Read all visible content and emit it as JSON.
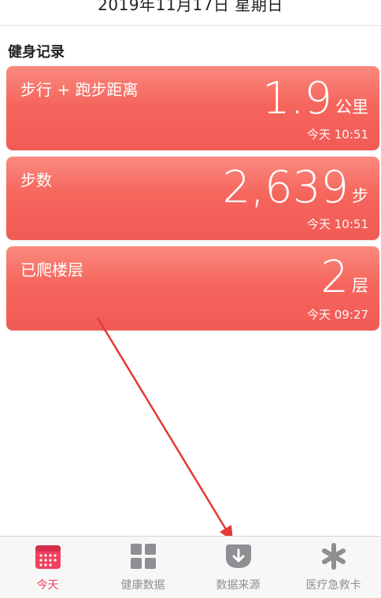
{
  "header": {
    "date": "2019年11月17日 星期日"
  },
  "section": {
    "title": "健身记录"
  },
  "cards": [
    {
      "label": "步行 + 跑步距离",
      "value": "1.9",
      "unit": "公里",
      "time": "今天 10:51"
    },
    {
      "label": "步数",
      "value": "2,639",
      "unit": "步",
      "time": "今天 10:51"
    },
    {
      "label": "已爬楼层",
      "value": "2",
      "unit": "层",
      "time": "今天 09:27"
    }
  ],
  "tabbar": {
    "tabs": [
      {
        "label": "今天",
        "icon": "calendar-icon",
        "active": true
      },
      {
        "label": "健康数据",
        "icon": "grid-icon",
        "active": false
      },
      {
        "label": "数据来源",
        "icon": "download-icon",
        "active": false
      },
      {
        "label": "医疗急救卡",
        "icon": "asterisk-icon",
        "active": false
      }
    ]
  },
  "colors": {
    "card": "#f5665d",
    "accent": "#f0415e",
    "tab_inactive": "#8e8e93",
    "annotation_arrow": "#e53935"
  }
}
